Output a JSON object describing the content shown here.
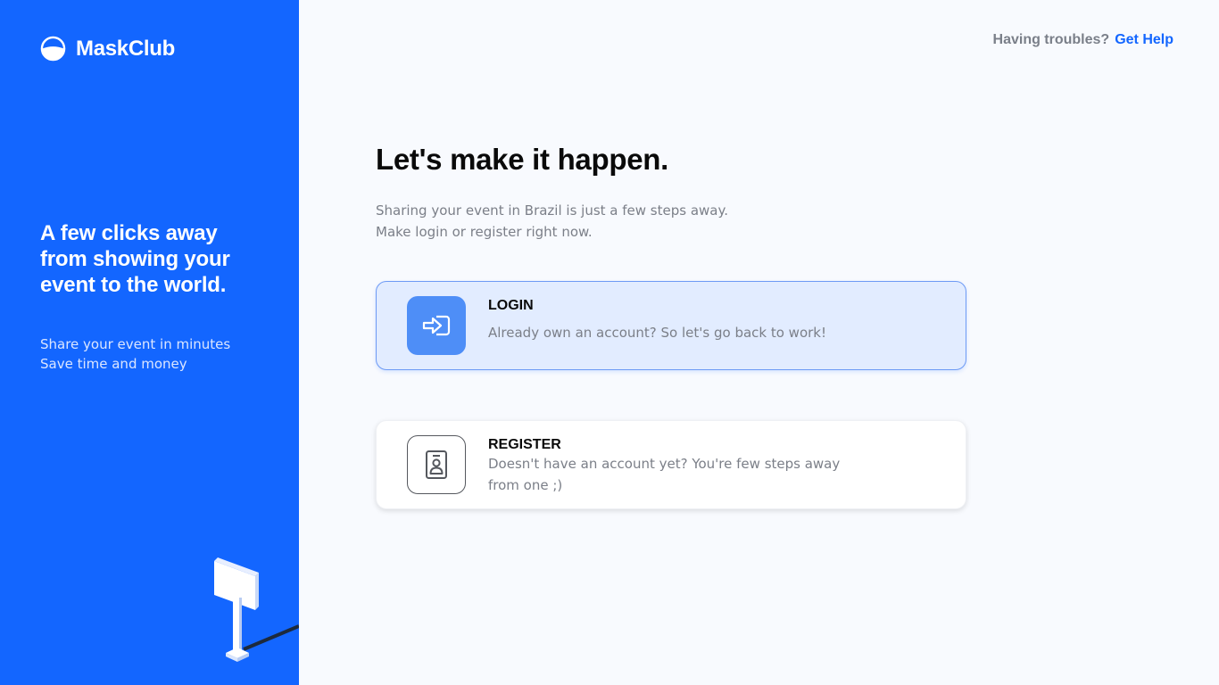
{
  "brand": {
    "name": "MaskClub"
  },
  "sidebar": {
    "tagline": "A few clicks away from showing your event to the world.",
    "sublines": [
      "Share your event in minutes",
      "Save time and money"
    ]
  },
  "help": {
    "question": "Having troubles?",
    "link": "Get Help"
  },
  "main": {
    "heading": "Let's make it happen.",
    "intro": [
      "Sharing your event in Brazil is just a few steps away.",
      "Make login or register right now."
    ]
  },
  "options": {
    "login": {
      "title": "LOGIN",
      "description": "Already own an account? So let's go back to work!",
      "icon": "login-arrow-icon",
      "selected": true
    },
    "register": {
      "title": "REGISTER",
      "description": "Doesn't have an account yet? You're few steps away from one ;)",
      "icon": "id-badge-icon",
      "selected": false
    }
  },
  "colors": {
    "brand_blue": "#1366ff",
    "selected_card_bg": "#e2ecff",
    "icon_blue": "#4e8ef7"
  }
}
